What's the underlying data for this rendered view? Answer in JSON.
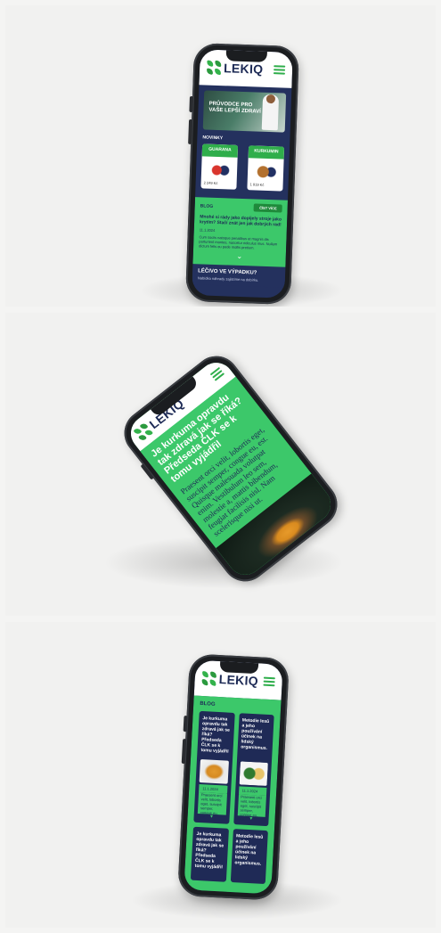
{
  "brand": {
    "name": "LEKIQ",
    "accent": "#3cc86a",
    "navy": "#1d2a55"
  },
  "phone1": {
    "hero_title": "PRŮVODCE PRO VAŠE LEPŠÍ ZDRAVÍ",
    "news_label": "NOVINKY",
    "products": [
      {
        "name": "GUARANA",
        "price": "2 249 Kč"
      },
      {
        "name": "KURKUMIN",
        "price": "1 919 Kč"
      }
    ],
    "blog_label": "BLOG",
    "blog_button": "ČÍST VÍCE",
    "blog_title": "Mnohé si rády jako dopíjely stroje jako krytím? Stačí znát jen jak dobrých rad!",
    "blog_date": "11.1.2024",
    "blog_text": "Cum sociis natoque penatibus et magnis dis parturient montes, nascetur ridiculus mus. Nullam dictum felis eu pede mollis pretium.",
    "chevron": "⌄",
    "dark_title": "LÉČIVO VE VÝPADKU?",
    "dark_text": "Nabídka náhrady zajistíme na dobírku."
  },
  "phone2": {
    "title": "Je kurkuma opravdu tak zdravá jak se říká? Předseda ČLK se k tomu vyjádřil",
    "para1": "Praesent orci velit, lobortis eget, suscipit semper, congue eu, est. Quisque malesuada volutpat enim. Vestibulum leo sem, molestie a, mattis bibendum, feugiat facilisis nisl. Nam scelerisque nisi ut.",
    "date": "11.1.2024",
    "para2": "Praesent orci velit, lobortis eget, suscipit semper, congue eu, est. Quisque malesuada volutpat enim. Vestibulum leo sem."
  },
  "phone3": {
    "blog_label": "BLOG",
    "cards": [
      {
        "title": "Je kurkuma opravdu tak zdravá jak se říká? Předseda ČLK se k tomu vyjádřil",
        "date": "11.1.2024",
        "text": "Praesent orci velit, lobortis eget, suscipit semper, congue eu, est."
      },
      {
        "title": "Metodie lesů a jeho používání účinek na lidský organismus.",
        "date": "11.1.2024",
        "text": "Praesent orci velit, lobortis eget, suscipit semper, congue eu, est."
      },
      {
        "title": "Je kurkuma opravdu tak zdravá jak se říká? Předseda ČLK se k tomu vyjádřil",
        "date": "",
        "text": ""
      },
      {
        "title": "Metodie lesů a jeho používání účinek na lidský organismus.",
        "date": "",
        "text": ""
      }
    ],
    "card_arrow": "▾"
  }
}
